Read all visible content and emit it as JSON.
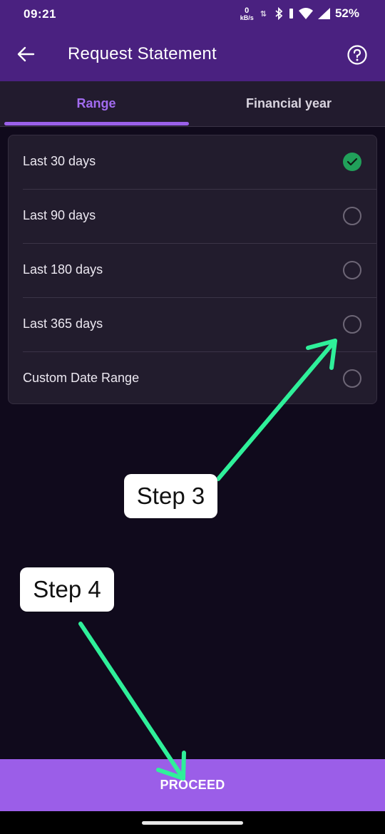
{
  "status_bar": {
    "time": "09:21",
    "net_speed_value": "0",
    "net_speed_unit": "kB/s",
    "battery": "52%"
  },
  "app_bar": {
    "title": "Request Statement",
    "back_icon": "arrow-left-icon",
    "help_icon": "question-circle-icon"
  },
  "tabs": [
    {
      "label": "Range",
      "selected": true
    },
    {
      "label": "Financial year",
      "selected": false
    }
  ],
  "range_options": [
    {
      "label": "Last 30 days",
      "selected": true
    },
    {
      "label": "Last 90 days",
      "selected": false
    },
    {
      "label": "Last 180 days",
      "selected": false
    },
    {
      "label": "Last 365 days",
      "selected": false
    },
    {
      "label": "Custom Date Range",
      "selected": false
    }
  ],
  "annotations": {
    "step3": "Step 3",
    "step4": "Step 4",
    "arrow_color": "#2ff09a"
  },
  "proceed_label": "PROCEED",
  "colors": {
    "app_bar": "#4a2180",
    "accent": "#9b5ee8",
    "selected_radio": "#21a05a",
    "background": "#100a1c"
  }
}
